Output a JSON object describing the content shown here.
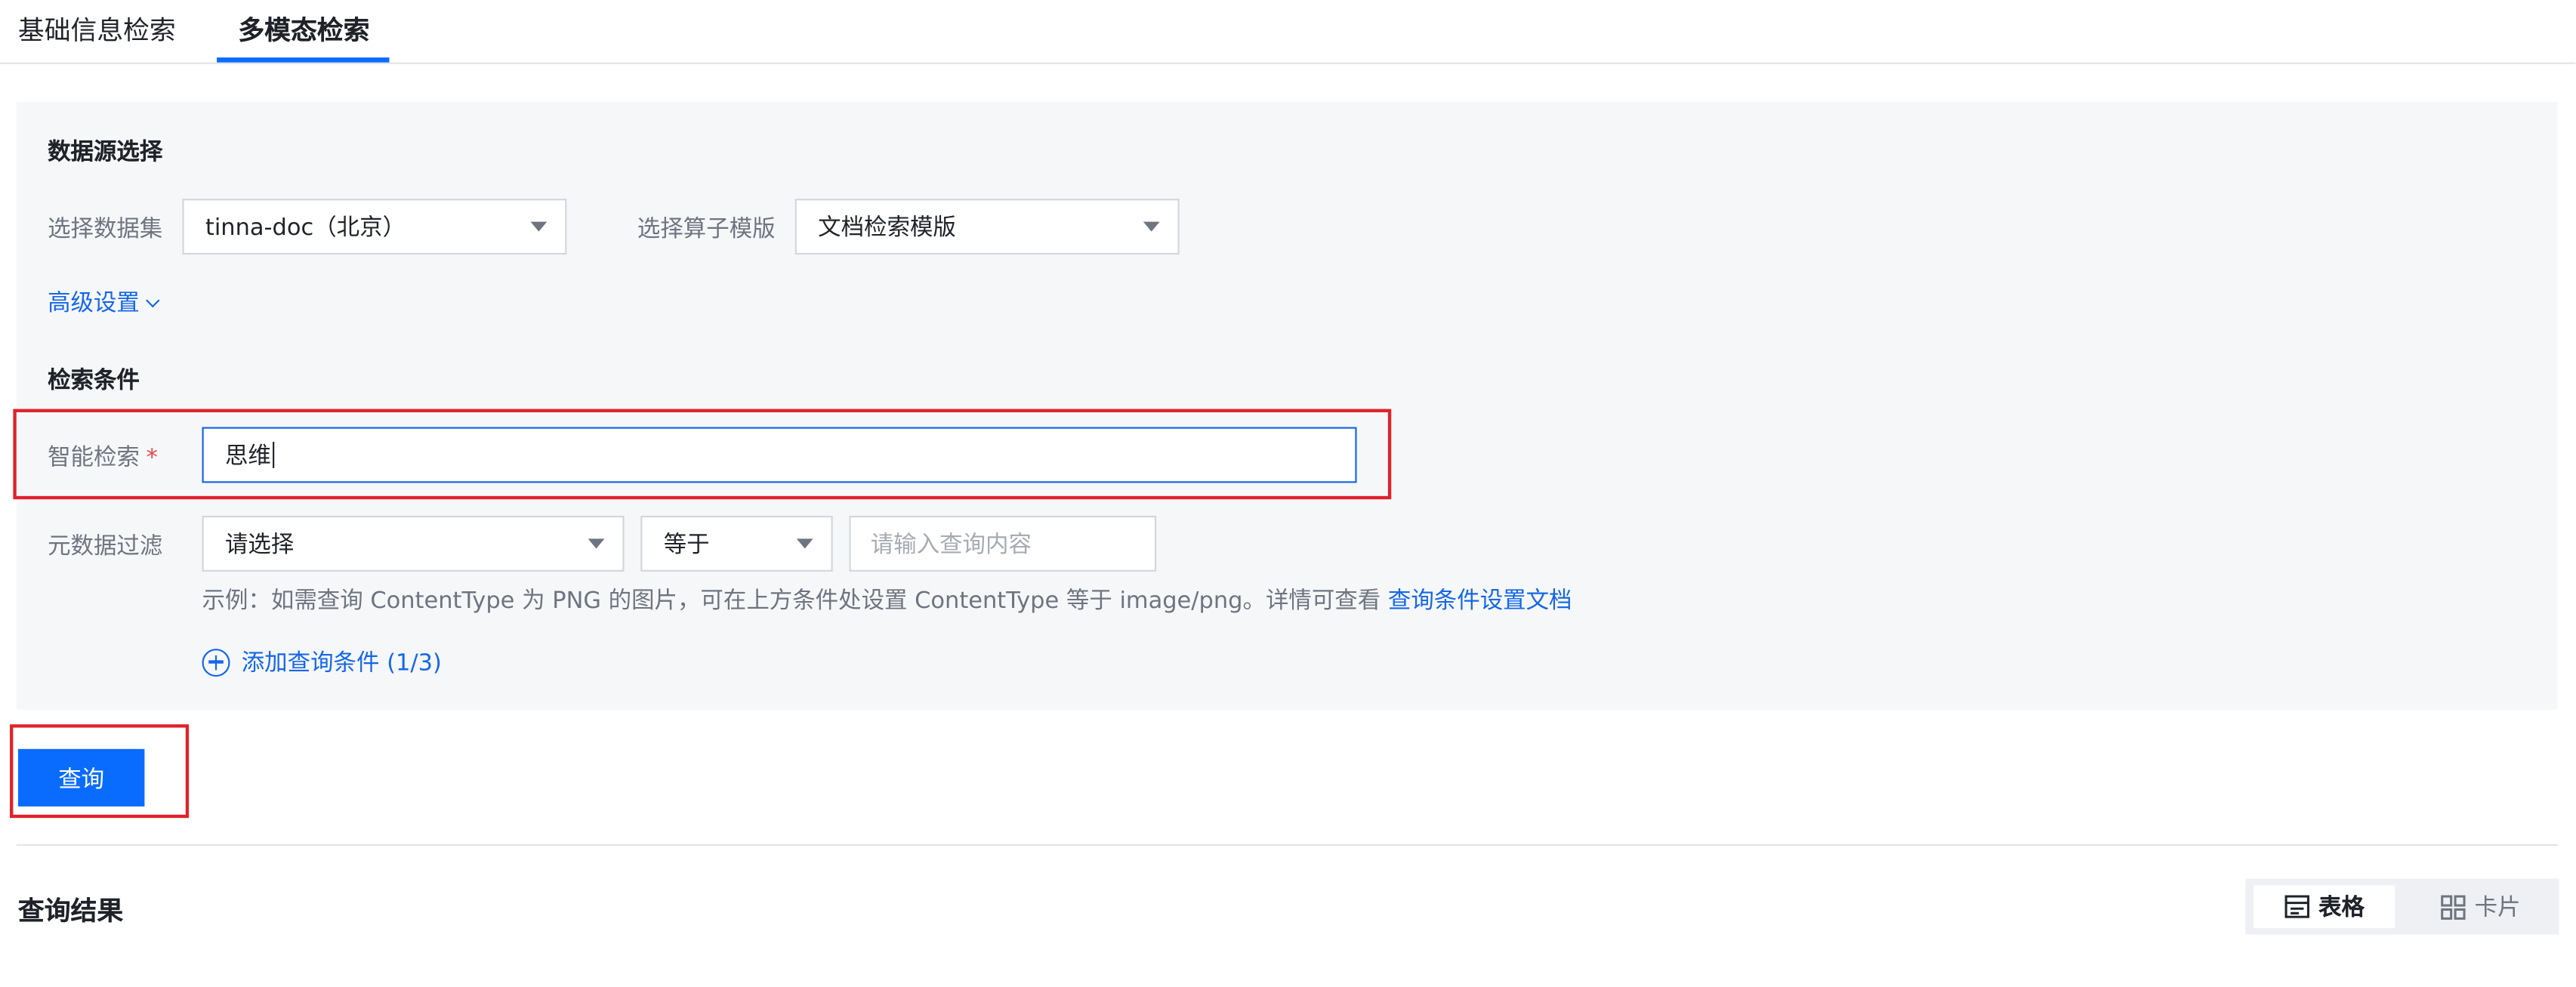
{
  "tabs": [
    {
      "label": "基础信息检索",
      "active": false
    },
    {
      "label": "多模态检索",
      "active": true
    }
  ],
  "datasource": {
    "title": "数据源选择",
    "dataset_label": "选择数据集",
    "dataset_value": "tinna-doc（北京）",
    "template_label": "选择算子模版",
    "template_value": "文档检索模版",
    "advanced_label": "高级设置"
  },
  "conditions": {
    "title": "检索条件",
    "smart_search_label": "智能检索",
    "required_mark": "*",
    "smart_search_value": "思维",
    "metadata_label": "元数据过滤",
    "metadata_field_value": "请选择",
    "operator_value": "等于",
    "query_placeholder": "请输入查询内容",
    "hint_text": "示例：如需查询 ContentType 为 PNG 的图片，可在上方条件处设置 ContentType 等于 image/png。详情可查看",
    "hint_link": "查询条件设置文档",
    "add_condition_label": "添加查询条件 (1/3)"
  },
  "query_button_label": "查询",
  "results": {
    "title": "查询结果",
    "view_table_label": "表格",
    "view_card_label": "卡片",
    "active_view": "table"
  },
  "colors": {
    "primary": "#0a6cff",
    "link": "#1567e8",
    "highlight": "#e0222b",
    "panel_bg": "#f6f7f9"
  }
}
